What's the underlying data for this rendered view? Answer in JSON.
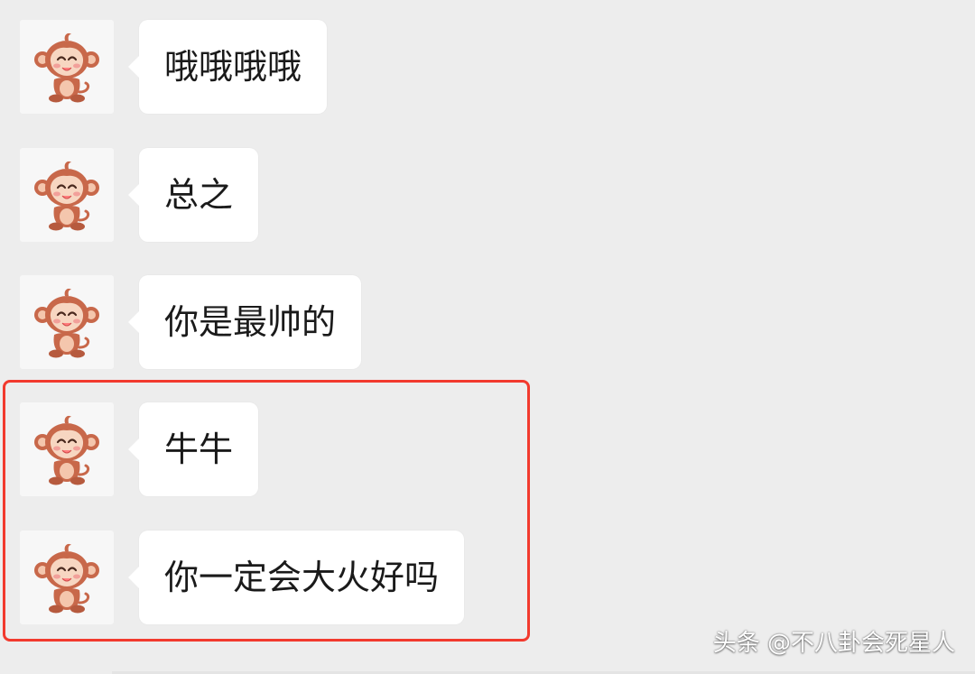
{
  "messages": [
    {
      "text": "哦哦哦哦"
    },
    {
      "text": "总之"
    },
    {
      "text": "你是最帅的"
    },
    {
      "text": "牛牛"
    },
    {
      "text": "你一定会大火好吗"
    }
  ],
  "watermark": "头条 @不八卦会死星人",
  "colors": {
    "background": "#ededed",
    "bubble": "#ffffff",
    "highlight": "#f23a2e",
    "avatar_bg": "#f7f7f7"
  },
  "icons": {
    "avatar": "monkey-avatar-icon"
  }
}
